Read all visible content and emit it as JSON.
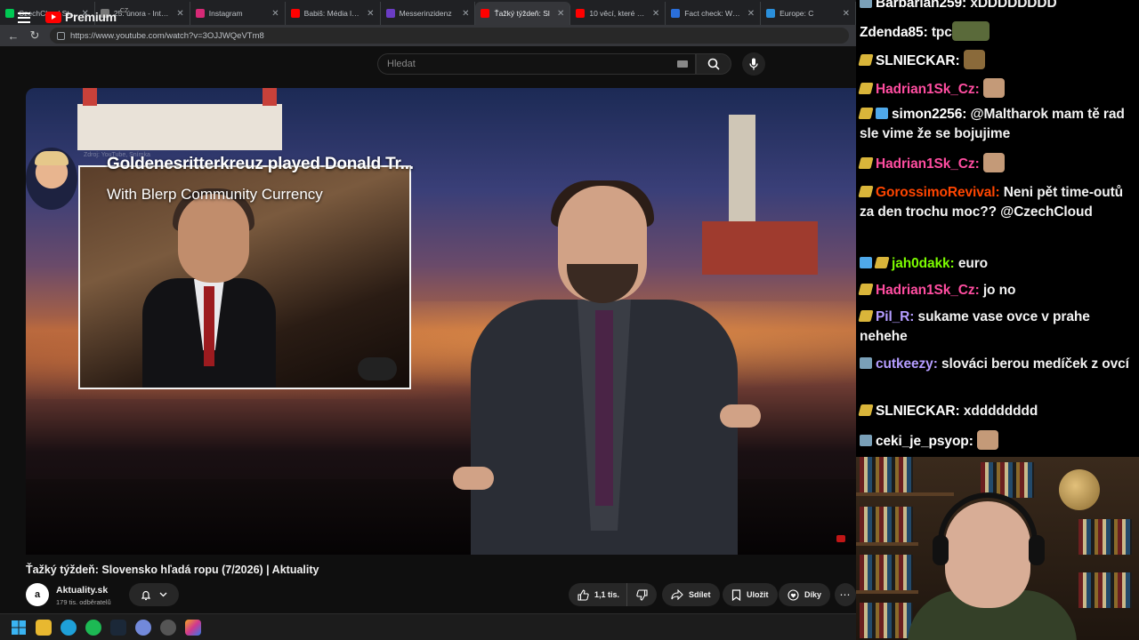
{
  "browser": {
    "tabs": [
      {
        "label": "CzechCloud Stream -",
        "color": "#00c853",
        "active": false
      },
      {
        "label": "25. února - Interview",
        "color": "#777777",
        "active": false
      },
      {
        "label": "Instagram",
        "color": "#d62976",
        "active": false
      },
      {
        "label": "Babiš: Média lžou, o",
        "color": "#ff0000",
        "active": false
      },
      {
        "label": "Messerinzidenz",
        "color": "#6a3cc4",
        "active": false
      },
      {
        "label": "Ťažký týždeň: Sl",
        "color": "#ff0000",
        "active": true
      },
      {
        "label": "10 věcí, které by Hitl",
        "color": "#ff0000",
        "active": false
      },
      {
        "label": "Fact check: Which co",
        "color": "#2a6fdb",
        "active": false
      },
      {
        "label": "Europe: C",
        "color": "#2a8fdb",
        "active": false
      }
    ],
    "url": "https://www.youtube.com/watch?v=3OJJWQeVTm8"
  },
  "youtube": {
    "logo_text": "Premium",
    "country_code": "CZ",
    "search_placeholder": "Hledat"
  },
  "video": {
    "source_label": "Zdroj: YouTube, Snímka",
    "overlay_title": "Goldenesritterkreuz played Donald Tr...",
    "overlay_subtitle": "With Blerp Community Currency",
    "title": "Ťažký týždeň: Slovensko hľadá ropu (7/2026) | Aktuality",
    "channel": {
      "avatar_letter": "a",
      "name": "Aktuality.sk",
      "subscribers": "179 tis. odběratelů"
    },
    "actions": {
      "like_count": "1,1 tis.",
      "share": "Sdílet",
      "save": "Uložit",
      "thanks": "Díky"
    }
  },
  "chat": {
    "messages": [
      {
        "user": "Barbarian259",
        "color": "#ffffff",
        "badges": [
          "prime"
        ],
        "text": "xDDDDDDDD",
        "emote": ""
      },
      {
        "user": "Zdenda85",
        "color": "#ffffff",
        "badges": [],
        "text": "tpc",
        "emote": "turtle"
      },
      {
        "user": "SLNIECKAR",
        "color": "#ffffff",
        "badges": [
          "bits"
        ],
        "text": "",
        "emote": "cat"
      },
      {
        "user": "Hadrian1Sk_Cz",
        "color": "#ff4da0",
        "badges": [
          "bits"
        ],
        "text": "",
        "emote": "face"
      },
      {
        "user": "simon2256",
        "color": "#ffffff",
        "badges": [
          "bits",
          "gift"
        ],
        "text": "@Maltharok mam tě rad sle vime že se bojujime",
        "emote": ""
      },
      {
        "user": "Hadrian1Sk_Cz",
        "color": "#ff4da0",
        "badges": [
          "bits"
        ],
        "text": "",
        "emote": "face"
      },
      {
        "user": "GorossimoRevival",
        "color": "#ff4500",
        "badges": [
          "bits"
        ],
        "text": "Neni pět time-outů za den trochu moc?? @CzechCloud",
        "emote": ""
      },
      {
        "user": "jah0dakk",
        "color": "#7cfc00",
        "badges": [
          "gift",
          "bits"
        ],
        "text": "euro",
        "emote": ""
      },
      {
        "user": "Hadrian1Sk_Cz",
        "color": "#ff4da0",
        "badges": [
          "bits"
        ],
        "text": "jo no",
        "emote": ""
      },
      {
        "user": "Pil_R",
        "color": "#b49cff",
        "badges": [
          "bits"
        ],
        "text": "sukame vase ovce v prahe nehehe",
        "emote": ""
      },
      {
        "user": "cutkeezy",
        "color": "#b49cff",
        "badges": [
          "prime"
        ],
        "text": "slováci berou medíček z ovcí",
        "emote": ""
      },
      {
        "user": "SLNIECKAR",
        "color": "#ffffff",
        "badges": [
          "bits"
        ],
        "text": "xdddddddd",
        "emote": ""
      },
      {
        "user": "ceki_je_psyop",
        "color": "#ffffff",
        "badges": [
          "prime"
        ],
        "text": "",
        "emote": "face"
      }
    ]
  }
}
